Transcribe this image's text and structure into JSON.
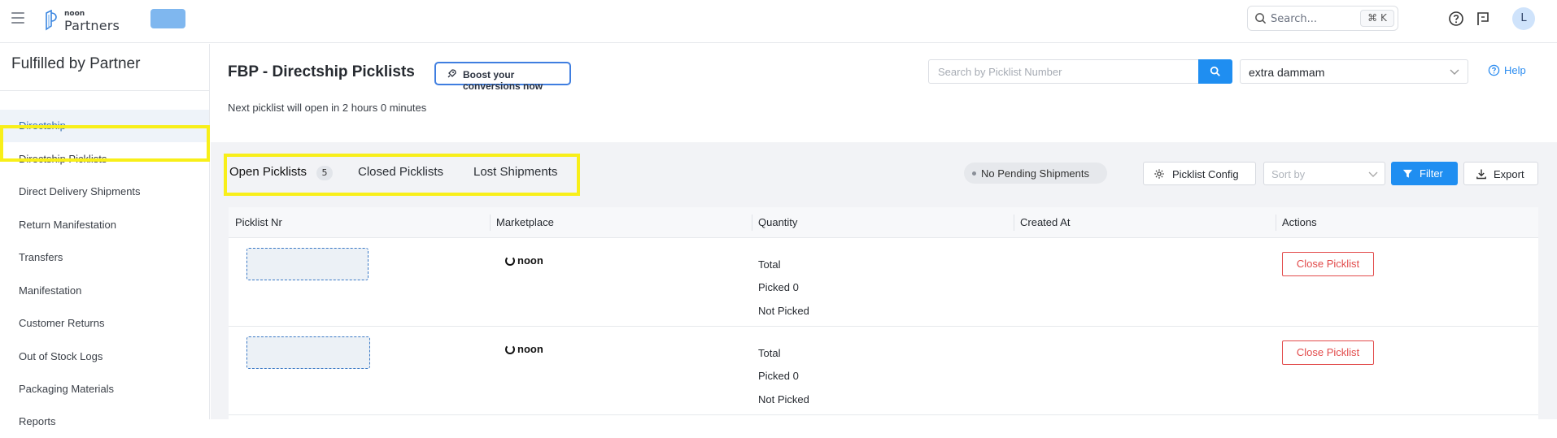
{
  "topbar": {
    "logo_small": "noon",
    "logo_text": "Partners",
    "search_placeholder": "Search...",
    "search_shortcut": "⌘ K",
    "avatar_initial": "L"
  },
  "sidebar": {
    "title": "Fulfilled by Partner",
    "items": [
      {
        "label": "Directship"
      },
      {
        "label": "Directship Picklists"
      },
      {
        "label": "Direct Delivery Shipments"
      },
      {
        "label": "Return Manifestation"
      },
      {
        "label": "Transfers"
      },
      {
        "label": "Manifestation"
      },
      {
        "label": "Customer Returns"
      },
      {
        "label": "Out of Stock Logs"
      },
      {
        "label": "Packaging Materials"
      },
      {
        "label": "Reports"
      }
    ]
  },
  "main": {
    "title": "FBP - Directship Picklists",
    "boost_label": "Boost your conversions now",
    "next_info": "Next picklist will open in 2 hours 0 minutes",
    "picklist_search_placeholder": "Search by Picklist Number",
    "warehouse": "extra dammam",
    "help_label": "Help"
  },
  "tabs": {
    "open": {
      "label": "Open Picklists",
      "count": "5"
    },
    "closed": {
      "label": "Closed Picklists"
    },
    "lost": {
      "label": "Lost Shipments"
    }
  },
  "toolbar": {
    "status": "No Pending Shipments",
    "config_label": "Picklist Config",
    "sort_placeholder": "Sort by",
    "filter_label": "Filter",
    "export_label": "Export"
  },
  "table": {
    "columns": [
      "Picklist Nr",
      "Marketplace",
      "Quantity",
      "Created At",
      "Actions"
    ],
    "rows": [
      {
        "marketplace": "noon",
        "total": "Total",
        "picked": "Picked 0",
        "not_picked": "Not Picked",
        "action": "Close Picklist"
      },
      {
        "marketplace": "noon",
        "total": "Total",
        "picked": "Picked 0",
        "not_picked": "Not Picked",
        "action": "Close Picklist"
      }
    ]
  },
  "colors": {
    "accent": "#1f8ef1",
    "highlight": "#f8ef19",
    "danger": "#e24b4b",
    "active_nav_bg": "#eef3f9"
  },
  "icons": [
    "hamburger-icon",
    "noon-partners-logo",
    "search-icon",
    "help-circle-icon",
    "flag-chat-icon",
    "rocket-icon",
    "chevron-down-icon",
    "gear-icon",
    "filter-icon",
    "download-icon"
  ]
}
